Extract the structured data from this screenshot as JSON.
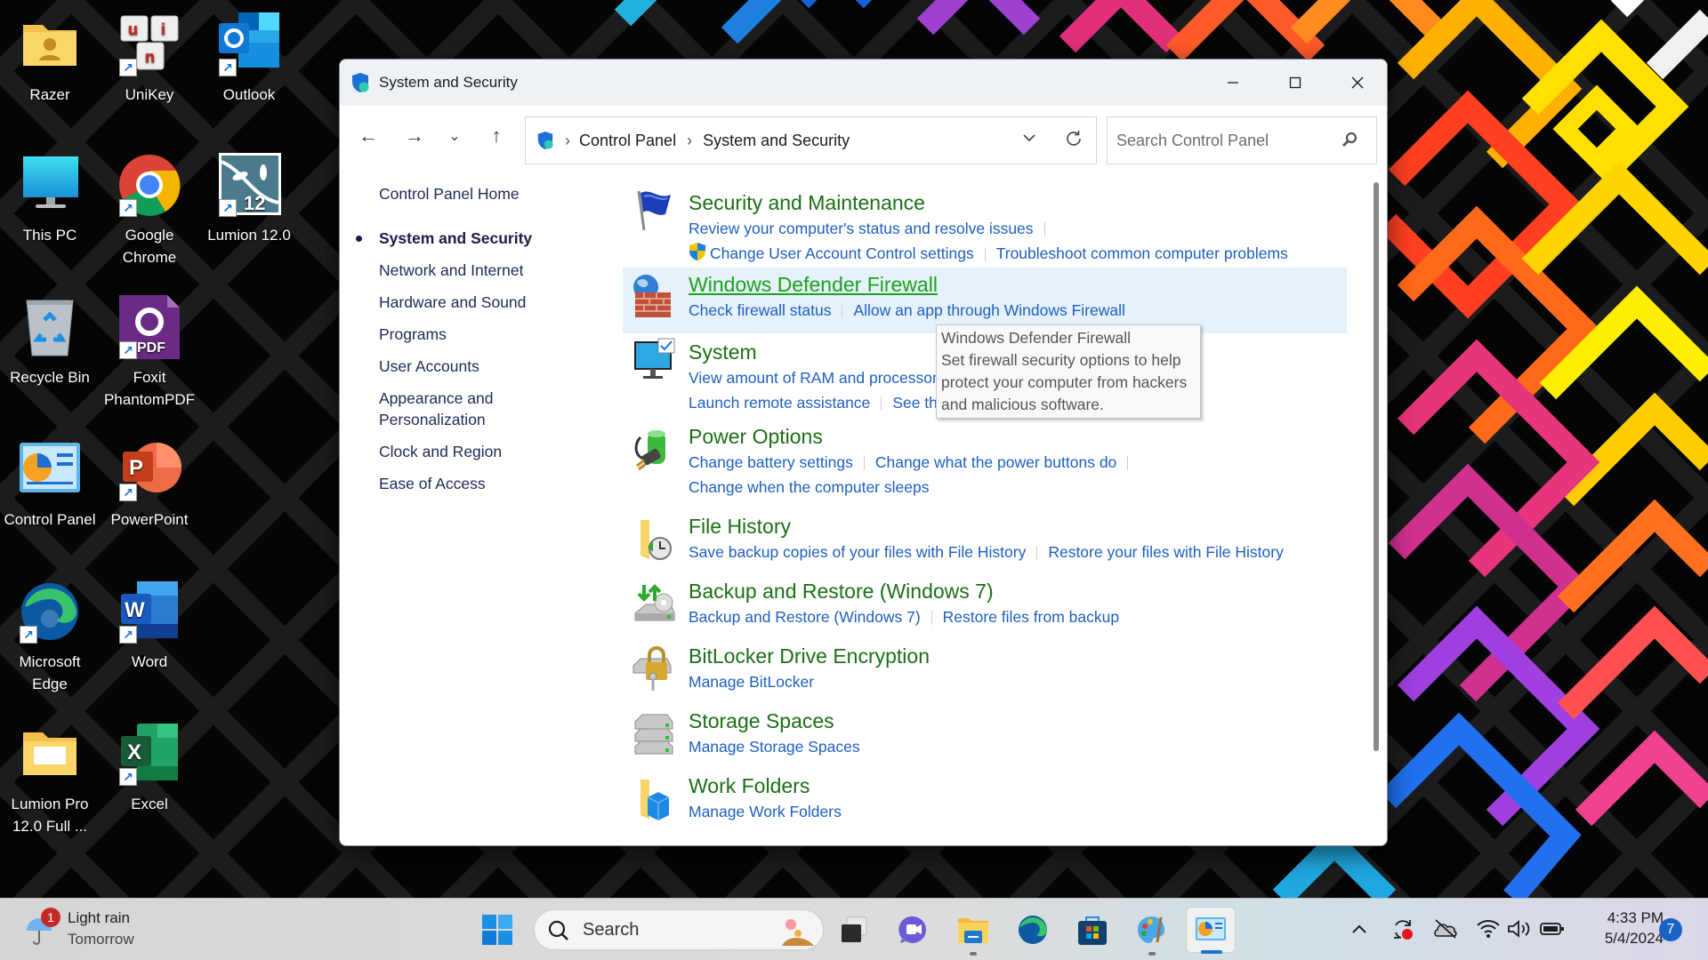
{
  "desktop": {
    "icons": [
      {
        "label": "Razer"
      },
      {
        "label": "UniKey"
      },
      {
        "label": "Outlook"
      },
      {
        "label": "This PC"
      },
      {
        "label": "Google Chrome"
      },
      {
        "label": "Lumion 12.0"
      },
      {
        "label": "Recycle Bin"
      },
      {
        "label": "Foxit PhantomPDF"
      },
      {
        "label": "Control Panel"
      },
      {
        "label": "PowerPoint"
      },
      {
        "label": "Microsoft Edge"
      },
      {
        "label": "Word"
      },
      {
        "label": "Lumion Pro 12.0 Full ..."
      },
      {
        "label": "Excel"
      }
    ]
  },
  "window": {
    "title": "System and Security",
    "breadcrumb": [
      "Control Panel",
      "System and Security"
    ],
    "search_placeholder": "Search Control Panel"
  },
  "left_nav": [
    {
      "label": "Control Panel Home"
    },
    {
      "label": "System and Security",
      "active": true
    },
    {
      "label": "Network and Internet"
    },
    {
      "label": "Hardware and Sound"
    },
    {
      "label": "Programs"
    },
    {
      "label": "User Accounts"
    },
    {
      "label": "Appearance and Personalization"
    },
    {
      "label": "Clock and Region"
    },
    {
      "label": "Ease of Access"
    }
  ],
  "categories": [
    {
      "title": "Security and Maintenance",
      "lines": [
        [
          "Review your computer's status and resolve issues"
        ],
        [
          "Change User Account Control settings",
          "Troubleshoot common computer problems"
        ]
      ]
    },
    {
      "title": "Windows Defender Firewall",
      "lines": [
        [
          "Check firewall status",
          "Allow an app through Windows Firewall"
        ]
      ]
    },
    {
      "title": "System",
      "lines": [
        [
          "View amount of RAM and processor speed"
        ],
        [
          "Launch remote assistance",
          "See the name of this computer"
        ]
      ]
    },
    {
      "title": "Power Options",
      "lines": [
        [
          "Change battery settings",
          "Change what the power buttons do"
        ],
        [
          "Change when the computer sleeps"
        ]
      ]
    },
    {
      "title": "File History",
      "lines": [
        [
          "Save backup copies of your files with File History",
          "Restore your files with File History"
        ]
      ]
    },
    {
      "title": "Backup and Restore (Windows 7)",
      "lines": [
        [
          "Backup and Restore (Windows 7)",
          "Restore files from backup"
        ]
      ]
    },
    {
      "title": "BitLocker Drive Encryption",
      "lines": [
        [
          "Manage BitLocker"
        ]
      ]
    },
    {
      "title": "Storage Spaces",
      "lines": [
        [
          "Manage Storage Spaces"
        ]
      ]
    },
    {
      "title": "Work Folders",
      "lines": [
        [
          "Manage Work Folders"
        ]
      ]
    }
  ],
  "tooltip": {
    "title": "Windows Defender Firewall",
    "lines": [
      "Set firewall security options to help",
      "protect your computer from hackers",
      "and malicious software."
    ]
  },
  "taskbar": {
    "weather": {
      "title": "Light rain",
      "subtitle": "Tomorrow",
      "badge": "1"
    },
    "search_label": "Search",
    "time": "4:33 PM",
    "date": "5/4/2024",
    "notification_count": "7"
  }
}
